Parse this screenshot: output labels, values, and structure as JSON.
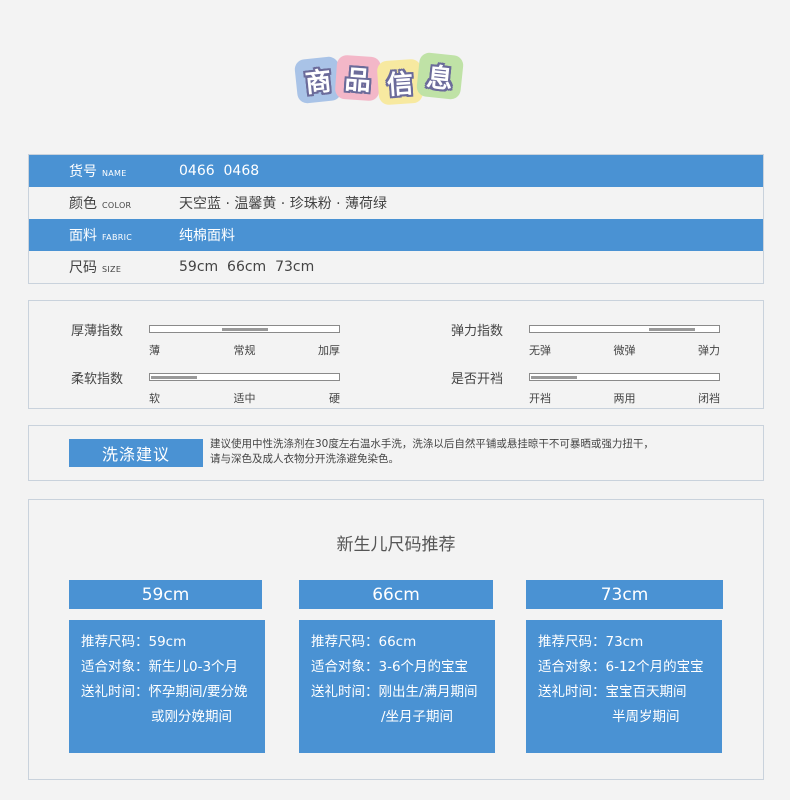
{
  "title": {
    "chars": [
      "商",
      "品",
      "信",
      "息"
    ],
    "colors": [
      "#a9c3e7",
      "#f3b7c8",
      "#f7e9a0",
      "#bfe2a6"
    ]
  },
  "info": [
    {
      "label": "货号",
      "en": "NAME",
      "value": "0466  0468",
      "highlight": true
    },
    {
      "label": "颜色",
      "en": "COLOR",
      "value": "天空蓝 · 温馨黄 · 珍珠粉 · 薄荷绿",
      "highlight": false
    },
    {
      "label": "面料",
      "en": "FABRIC",
      "value": "纯棉面料",
      "highlight": true
    },
    {
      "label": "尺码",
      "en": "SIZE",
      "value": "59cm  66cm  73cm",
      "highlight": false
    }
  ],
  "indices": [
    {
      "name": "厚薄指数",
      "ticks": [
        "薄",
        "常规",
        "加厚"
      ],
      "level": 0.5
    },
    {
      "name": "弹力指数",
      "ticks": [
        "无弹",
        "微弹",
        "弹力"
      ],
      "level": 0.75
    },
    {
      "name": "柔软指数",
      "ticks": [
        "软",
        "适中",
        "硬"
      ],
      "level": 0.12
    },
    {
      "name": "是否开裆",
      "ticks": [
        "开裆",
        "两用",
        "闭裆"
      ],
      "level": 0.12
    }
  ],
  "wash": {
    "title": "洗涤建议",
    "line1": "建议使用中性洗涤剂在30度左右温水手洗，洗涤以后自然平铺或悬挂晾干不可暴晒或强力扭干，",
    "line2": "请与深色及成人衣物分开洗涤避免染色。"
  },
  "size_section": {
    "title": "新生儿尺码推荐",
    "columns": [
      {
        "header": "59cm",
        "lines": [
          "推荐尺码：59cm",
          "适合对象：新生儿0-3个月",
          "送礼时间：怀孕期间/要分娩",
          "或刚分娩期间"
        ]
      },
      {
        "header": "66cm",
        "lines": [
          "推荐尺码：66cm",
          "适合对象：3-6个月的宝宝",
          "送礼时间：刚出生/满月期间",
          "/坐月子期间"
        ]
      },
      {
        "header": "73cm",
        "lines": [
          "推荐尺码：73cm",
          "适合对象：6-12个月的宝宝",
          "送礼时间：宝宝百天期间",
          "半周岁期间"
        ]
      }
    ]
  },
  "colors": {
    "accent": "#4a92d3",
    "border": "#c9d2dc",
    "background": "#f3f3f3"
  }
}
